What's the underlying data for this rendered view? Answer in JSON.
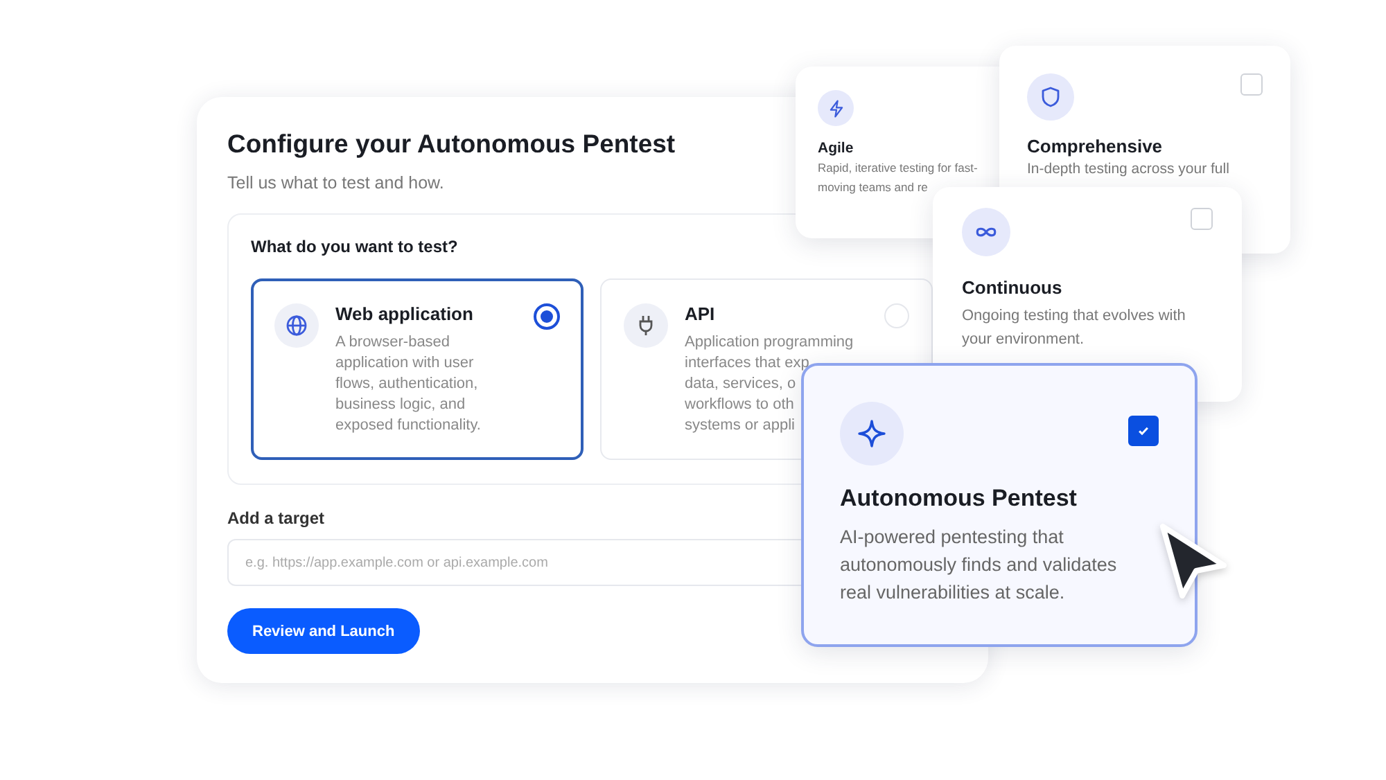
{
  "form": {
    "title": "Configure your Autonomous Pentest",
    "subtitle": "Tell us what to test and how.",
    "question": "What do you want to test?",
    "options": [
      {
        "title": "Web application",
        "lines": [
          "A browser-based",
          "application with user",
          "flows, authentication,",
          "business logic, and",
          "exposed functionality."
        ],
        "selected": true
      },
      {
        "title": "API",
        "lines": [
          "Application programming",
          "interfaces that exp",
          "data, services, o",
          "workflows to oth",
          "systems or appli"
        ],
        "selected": false
      }
    ],
    "target_label": "Add a target",
    "target": {
      "placeholder": "e.g. https://app.example.com or api.example.com"
    },
    "submit": "Review and Launch"
  },
  "features": [
    {
      "title": "Agile",
      "lines": [
        "Rapid, iterative testing for fast-",
        "moving teams and re"
      ]
    },
    {
      "title": "Comprehensive",
      "lines": [
        "In-depth testing across your full"
      ],
      "checked": false
    },
    {
      "title": "Continuous",
      "lines": [
        "Ongoing testing that evolves with",
        "your environment."
      ],
      "checked": false
    },
    {
      "title": "Autonomous Pentest",
      "lines": [
        "AI-powered pentesting that",
        "autonomously finds and validates",
        "real vulnerabilities at scale."
      ],
      "checked": true
    }
  ]
}
